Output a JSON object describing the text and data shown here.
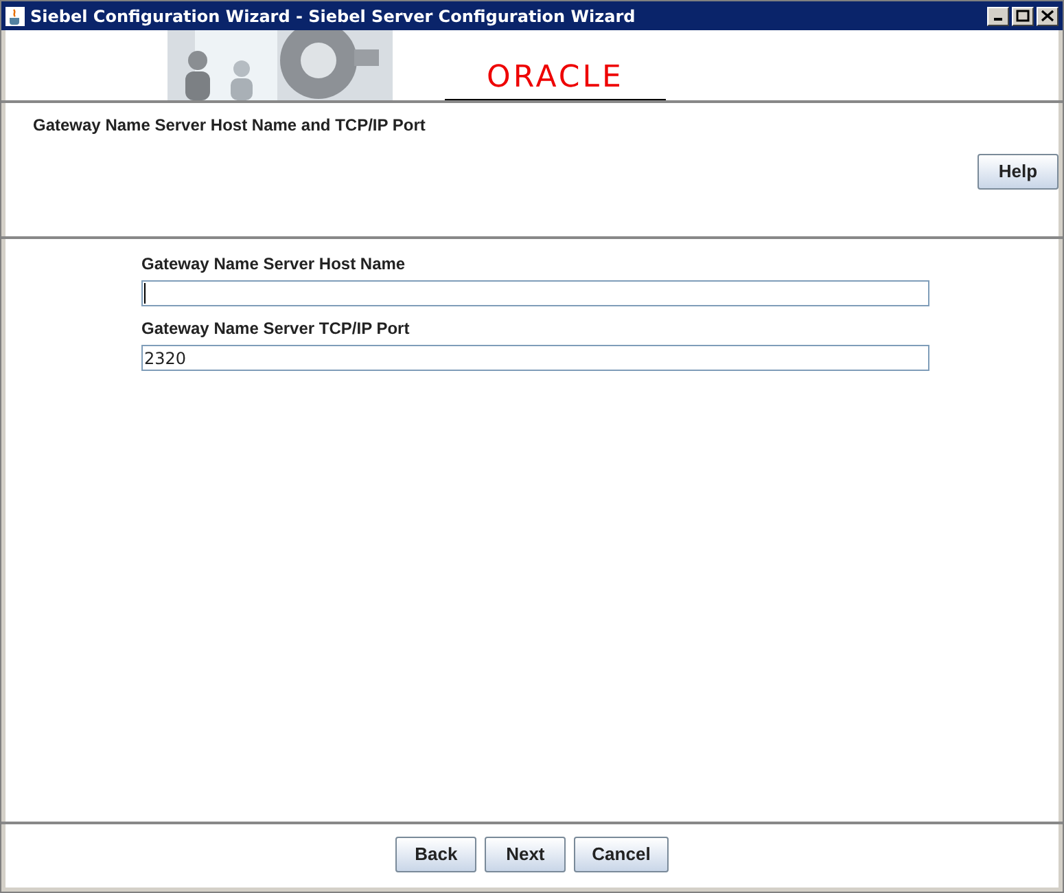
{
  "window": {
    "title": "Siebel Configuration Wizard - Siebel Server Configuration Wizard"
  },
  "banner": {
    "logo": "ORACLE"
  },
  "header": {
    "title": "Gateway Name Server Host Name and TCP/IP Port",
    "help_button": "Help"
  },
  "fields": [
    {
      "label": "Gateway Name Server Host Name",
      "focused": true
    },
    {
      "label": "Gateway Name Server TCP/IP Port",
      "value": "2320",
      "focused": false
    }
  ],
  "buttons": [
    "Back",
    "Next",
    "Cancel"
  ]
}
